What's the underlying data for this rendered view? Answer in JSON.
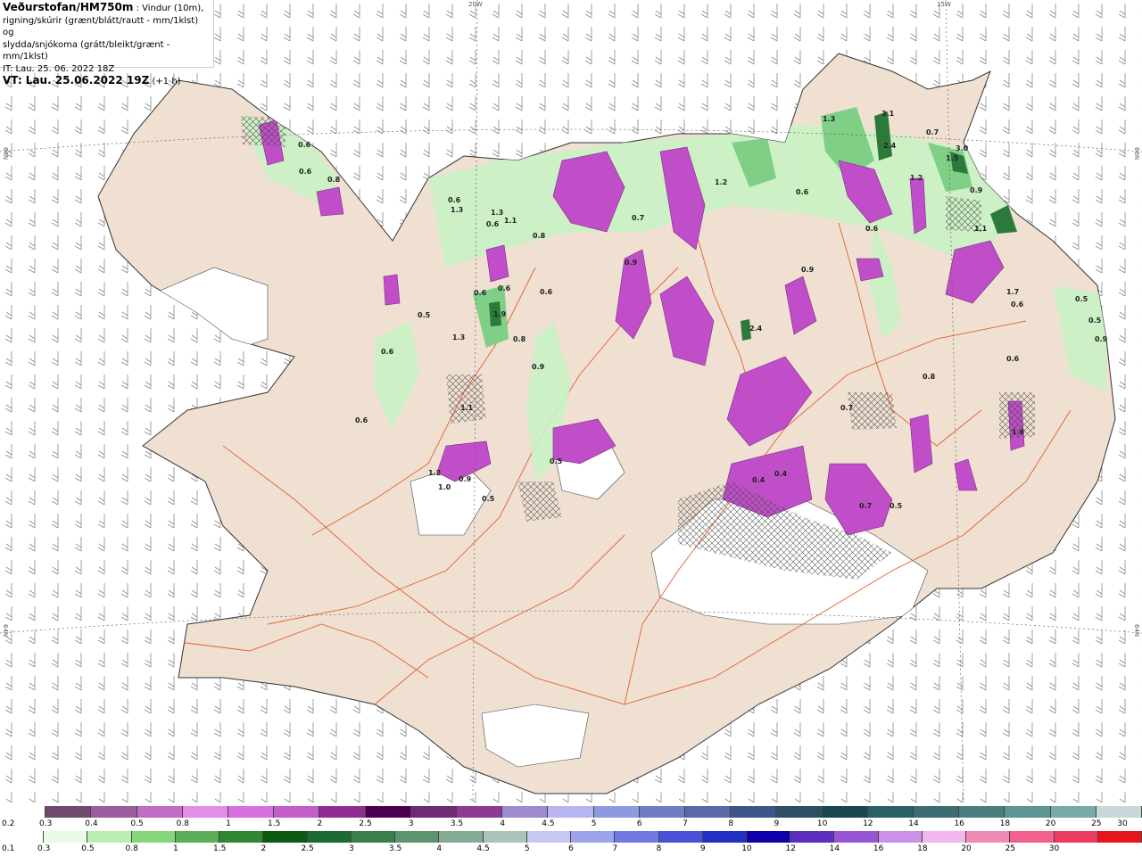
{
  "header": {
    "brand": "Veðurstofan/HM750m",
    "line1_rest": " : Vindur (10m),",
    "line2": "rigning/skúrir (grænt/blátt/rautt - mm/1klst) og",
    "line3": "slydda/snjókoma (grátt/bleikt/grænt - mm/1klst)",
    "it": "IT: Lau. 25. 06. 2022 18Z",
    "vt_bold": "VT: Lau. 25.06.2022 19Z",
    "vt_rest": " (+1 h)"
  },
  "grid_labels": {
    "lon_20w": "20W",
    "lon_15w": "15W",
    "lat_66n_left": "66N",
    "lat_66n_right": "66N",
    "lat_64n_left": "64N",
    "lat_64n_right": "64N"
  },
  "colors": {
    "land": "#efe0d2",
    "glacier": "#ffffff",
    "road": "#e3602e",
    "rain_light": "#c9f2c4",
    "rain_mid": "#7fcf86",
    "rain_dark": "#2c7a3b",
    "snow_light": "#d887dc",
    "snow_mid": "#c14ec9",
    "snow_dark": "#7a2a7f"
  },
  "precip_labels": [
    "0.6",
    "0.8",
    "0.6",
    "1.3",
    "1.1",
    "0.6",
    "0.6",
    "1.9",
    "0.6",
    "0.6",
    "1.3",
    "0.5",
    "0.6",
    "1.0",
    "0.9",
    "0.5",
    "1.1",
    "0.7",
    "0.9",
    "0.6",
    "0.8",
    "0.9",
    "0.8",
    "2.4",
    "1.2",
    "0.6",
    "1.3",
    "3.1",
    "2.4",
    "0.7",
    "1.5",
    "3.0",
    "0.9",
    "1.2",
    "1.1",
    "0.9",
    "1.7",
    "0.6",
    "0.4",
    "0.4",
    "0.7",
    "0.5",
    "0.7",
    "0.5",
    "0.6",
    "1.6",
    "0.5",
    "0.8",
    "0.9",
    "0.6",
    "1.3",
    "1.2",
    "0.6",
    "0.5"
  ],
  "snow_scale": {
    "colors": [
      "#6e4a6e",
      "#9a5c9e",
      "#c06ec4",
      "#e38de6",
      "#d870df",
      "#c45ec9",
      "#8e2e92",
      "#4e0050",
      "#6e2a72",
      "#8c3a94",
      "#9e8ad0",
      "#b8b4f0",
      "#8e9ae0",
      "#6f7dc4",
      "#5868a8",
      "#3d5588",
      "#2c4f63",
      "#18474f",
      "#2b5f66",
      "#3a6e70",
      "#4b7e7e",
      "#5f9494",
      "#79aaaa",
      "#c8d8d8"
    ],
    "labels": [
      "0.2",
      "0.3",
      "0.4",
      "0.5",
      "0.8",
      "1",
      "1.5",
      "2",
      "2.5",
      "3",
      "3.5",
      "4",
      "4.5",
      "5",
      "6",
      "7",
      "8",
      "9",
      "10",
      "12",
      "14",
      "16",
      "18",
      "20",
      "25",
      "30"
    ]
  },
  "rain_scale": {
    "colors": [
      "#e9fbe4",
      "#b8efb0",
      "#86d67e",
      "#5dae58",
      "#2f8633",
      "#0d5a12",
      "#1c6b32",
      "#3b7e4e",
      "#5c9470",
      "#84ab94",
      "#aac4bc",
      "#c6c8f0",
      "#9ca3ea",
      "#7279e3",
      "#4a51d6",
      "#2230c2",
      "#1000a8",
      "#5a2fc0",
      "#9856d4",
      "#cc90e8",
      "#f0b8ec",
      "#f28ab8",
      "#f2608e",
      "#ee3c60",
      "#e8141e"
    ],
    "labels": [
      "0.1",
      "0.3",
      "0.5",
      "0.8",
      "1",
      "1.5",
      "2",
      "2.5",
      "3",
      "3.5",
      "4",
      "4.5",
      "5",
      "6",
      "7",
      "8",
      "9",
      "10",
      "12",
      "14",
      "16",
      "18",
      "20",
      "25",
      "30"
    ]
  }
}
